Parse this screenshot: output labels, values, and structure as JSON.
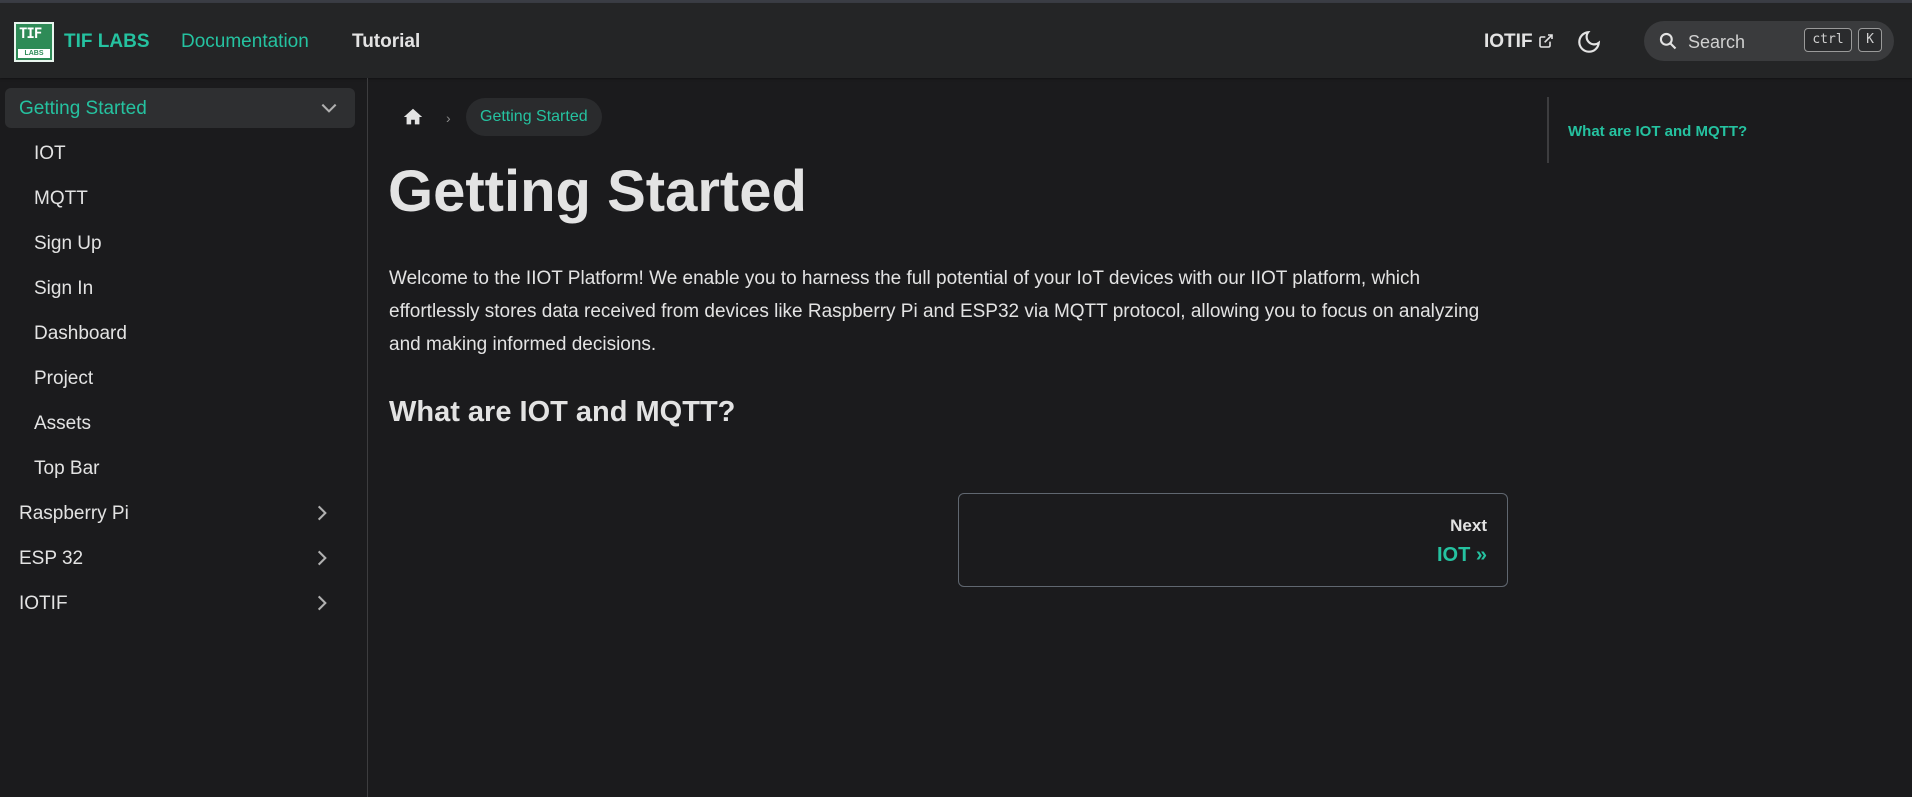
{
  "navbar": {
    "brand": "TIF LABS",
    "logo_text": "TIF",
    "logo_sub": "LABS",
    "links": [
      "Documentation",
      "Tutorial"
    ],
    "external_link": "IOTIF",
    "search_placeholder": "Search",
    "shortcut_keys": [
      "ctrl",
      "K"
    ]
  },
  "sidebar": {
    "items": [
      {
        "label": "Getting Started",
        "active": true,
        "chevron": "down"
      },
      {
        "label": "IOT"
      },
      {
        "label": "MQTT"
      },
      {
        "label": "Sign Up"
      },
      {
        "label": "Sign In"
      },
      {
        "label": "Dashboard"
      },
      {
        "label": "Project"
      },
      {
        "label": "Assets"
      },
      {
        "label": "Top Bar"
      },
      {
        "label": "Raspberry Pi",
        "chevron": "right"
      },
      {
        "label": "ESP 32",
        "chevron": "right"
      },
      {
        "label": "IOTIF",
        "chevron": "right"
      }
    ]
  },
  "breadcrumb": {
    "current": "Getting Started"
  },
  "article": {
    "title": "Getting Started",
    "intro": "Welcome to the IIOT Platform! We enable you to harness the full potential of your IoT devices with our IIOT platform, which effortlessly stores data received from devices like Raspberry Pi and ESP32 via MQTT protocol, allowing you to focus on analyzing and making informed decisions.",
    "heading": "What are IOT and MQTT?"
  },
  "pagination": {
    "next_label": "Next",
    "next_title": "IOT »"
  },
  "toc": {
    "items": [
      "What are IOT and MQTT?"
    ]
  },
  "colors": {
    "accent": "#25c2a0",
    "background": "#1b1b1d",
    "navbar": "#242526"
  }
}
